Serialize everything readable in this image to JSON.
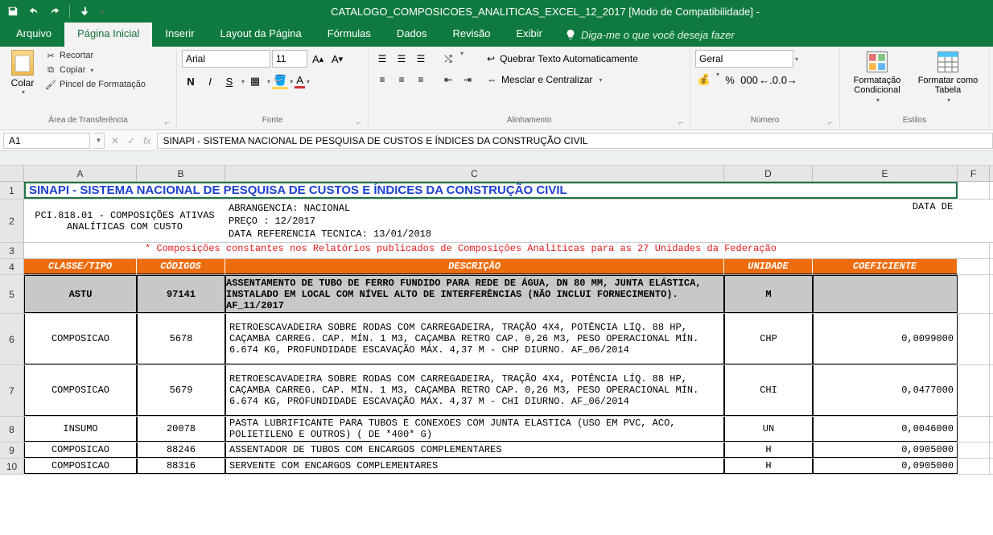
{
  "window": {
    "title": "CATALOGO_COMPOSICOES_ANALITICAS_EXCEL_12_2017  [Modo de Compatibilidade]  -"
  },
  "tabs": {
    "arquivo": "Arquivo",
    "pagina_inicial": "Página Inicial",
    "inserir": "Inserir",
    "layout": "Layout da Página",
    "formulas": "Fórmulas",
    "dados": "Dados",
    "revisao": "Revisão",
    "exibir": "Exibir",
    "tellme": "Diga-me o que você deseja fazer"
  },
  "ribbon": {
    "clipboard": {
      "paste": "Colar",
      "cut": "Recortar",
      "copy": "Copiar",
      "format_painter": "Pincel de Formatação",
      "group": "Área de Transferência"
    },
    "font": {
      "name": "Arial",
      "size": "11",
      "group": "Fonte"
    },
    "alignment": {
      "wrap": "Quebrar Texto Automaticamente",
      "merge": "Mesclar e Centralizar",
      "group": "Alinhamento"
    },
    "number": {
      "format": "Geral",
      "group": "Número"
    },
    "styles": {
      "cond": "Formatação Condicional",
      "table": "Formatar como Tabela",
      "group": "Estilos"
    }
  },
  "fbar": {
    "namebox": "A1",
    "formula": "SINAPI - SISTEMA NACIONAL DE PESQUISA DE CUSTOS E ÍNDICES DA CONSTRUÇÃO CIVIL"
  },
  "cols": {
    "A": "A",
    "B": "B",
    "C": "C",
    "D": "D",
    "E": "E",
    "F": "F"
  },
  "rows": {
    "1": "1",
    "2": "2",
    "3": "3",
    "4": "4",
    "5": "5",
    "6": "6",
    "7": "7",
    "8": "8",
    "9": "9",
    "10": "10"
  },
  "sheet": {
    "title": "SINAPI - SISTEMA NACIONAL DE PESQUISA DE CUSTOS E ÍNDICES DA CONSTRUÇÃO CIVIL",
    "meta_left": "PCI.818.01 - COMPOSIÇÕES ATIVAS ANALÍTICAS COM CUSTO",
    "meta_l1": "ABRANGENCIA: NACIONAL",
    "meta_l2": "PREÇO           :   12/2017",
    "meta_l3": "DATA REFERENCIA TECNICA: 13/01/2018",
    "meta_right": "DATA DE",
    "note": "* Composições constantes nos Relatórios publicados de Composições Analíticas para as 27 Unidades da Federação",
    "headers": {
      "classe": "CLASSE/TIPO",
      "codigos": "CÓDIGOS",
      "descricao": "DESCRIÇÃO",
      "unidade": "UNIDADE",
      "coef": "COEFICIENTE"
    },
    "row5": {
      "classe": "ASTU",
      "codigo": "97141",
      "desc": "ASSENTAMENTO DE TUBO DE FERRO FUNDIDO PARA REDE DE ÁGUA, DN 80 MM, JUNTA ELÁSTICA, INSTALADO EM LOCAL COM NÍVEL ALTO DE INTERFERÊNCIAS (NÃO INCLUI FORNECIMENTO). AF_11/2017",
      "unid": "M",
      "coef": ""
    },
    "data": [
      {
        "classe": "COMPOSICAO",
        "codigo": "5678",
        "desc": "RETROESCAVADEIRA SOBRE RODAS COM CARREGADEIRA, TRAÇÃO 4X4, POTÊNCIA LÍQ. 88 HP, CAÇAMBA CARREG. CAP. MÍN. 1 M3, CAÇAMBA RETRO CAP. 0,26 M3, PESO OPERACIONAL MÍN. 6.674 KG, PROFUNDIDADE ESCAVAÇÃO MÁX. 4,37 M - CHP DIURNO. AF_06/2014",
        "unid": "CHP",
        "coef": "0,0099000"
      },
      {
        "classe": "COMPOSICAO",
        "codigo": "5679",
        "desc": "RETROESCAVADEIRA SOBRE RODAS COM CARREGADEIRA, TRAÇÃO 4X4, POTÊNCIA LÍQ. 88 HP, CAÇAMBA CARREG. CAP. MÍN. 1 M3, CAÇAMBA RETRO CAP. 0,26 M3, PESO OPERACIONAL MÍN. 6.674 KG, PROFUNDIDADE ESCAVAÇÃO MÁX. 4,37 M - CHI DIURNO. AF_06/2014",
        "unid": "CHI",
        "coef": "0,0477000"
      },
      {
        "classe": "INSUMO",
        "codigo": "20078",
        "desc": "PASTA LUBRIFICANTE PARA TUBOS E CONEXOES COM JUNTA ELASTICA (USO EM PVC, ACO, POLIETILENO E OUTROS) ( DE *400* G)",
        "unid": "UN",
        "coef": "0,0046000"
      },
      {
        "classe": "COMPOSICAO",
        "codigo": "88246",
        "desc": "ASSENTADOR DE TUBOS COM ENCARGOS COMPLEMENTARES",
        "unid": "H",
        "coef": "0,0905000"
      },
      {
        "classe": "COMPOSICAO",
        "codigo": "88316",
        "desc": "SERVENTE COM ENCARGOS COMPLEMENTARES",
        "unid": "H",
        "coef": "0,0905000"
      }
    ]
  }
}
